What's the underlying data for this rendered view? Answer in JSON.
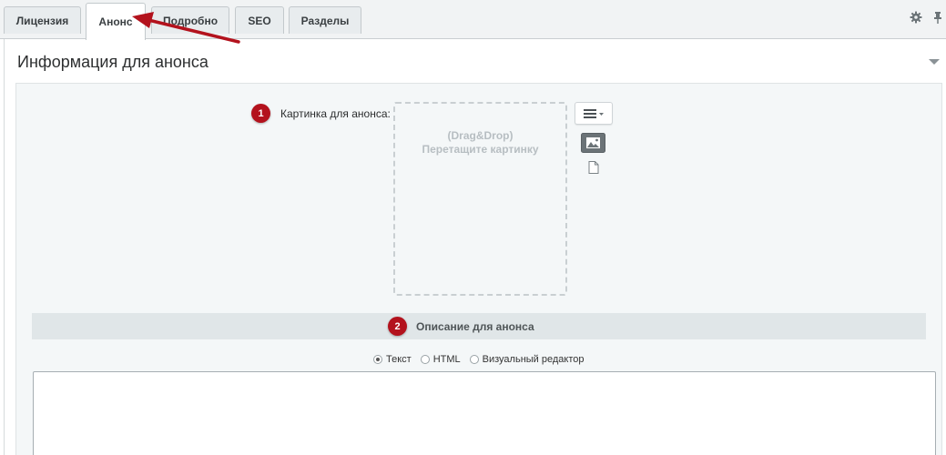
{
  "tabs": [
    {
      "label": "Лицензия",
      "active": false
    },
    {
      "label": "Анонс",
      "active": true
    },
    {
      "label": "Подробно",
      "active": false
    },
    {
      "label": "SEO",
      "active": false
    },
    {
      "label": "Разделы",
      "active": false
    }
  ],
  "toolbar": {
    "icons": [
      "gear-icon",
      "pin-icon"
    ]
  },
  "section": {
    "title": "Информация для анонса",
    "collapse_icon": "chevron-down-icon"
  },
  "preview_image": {
    "badge": "1",
    "label": "Картинка для анонса:",
    "dropzone_line1": "(Drag&Drop)",
    "dropzone_line2": "Перетащите картинку",
    "icons": [
      "menu-icon",
      "image-icon",
      "file-icon"
    ]
  },
  "description": {
    "badge": "2",
    "label": "Описание для анонса",
    "modes": [
      {
        "label": "Текст",
        "checked": true
      },
      {
        "label": "HTML",
        "checked": false
      },
      {
        "label": "Визуальный редактор",
        "checked": false
      }
    ],
    "text_value": ""
  },
  "colors": {
    "badge": "#b3121d",
    "arrow": "#b3121d"
  }
}
